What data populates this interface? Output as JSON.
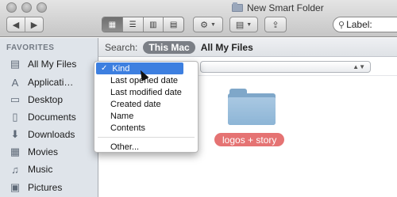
{
  "window": {
    "title": "New Smart Folder",
    "controls": [
      "close",
      "minimize",
      "zoom"
    ]
  },
  "toolbar": {
    "nav": {
      "back_glyph": "◀",
      "forward_glyph": "▶"
    },
    "view_modes": [
      {
        "name": "icon-view",
        "glyph": "▦",
        "active": true
      },
      {
        "name": "list-view",
        "glyph": "☰",
        "active": false
      },
      {
        "name": "column-view",
        "glyph": "▥",
        "active": false
      },
      {
        "name": "coverflow-view",
        "glyph": "▤",
        "active": false
      }
    ],
    "action_glyph": "⚙",
    "arrange_glyph": "▤",
    "share_glyph": "⇪",
    "search_text": "Label:"
  },
  "sidebar": {
    "heading": "FAVORITES",
    "items": [
      {
        "label": "All My Files",
        "icon": "all-files-icon",
        "glyph": "▤"
      },
      {
        "label": "Applicati…",
        "icon": "applications-icon",
        "glyph": "A"
      },
      {
        "label": "Desktop",
        "icon": "desktop-icon",
        "glyph": "▭"
      },
      {
        "label": "Documents",
        "icon": "documents-icon",
        "glyph": "▯"
      },
      {
        "label": "Downloads",
        "icon": "downloads-icon",
        "glyph": "⬇"
      },
      {
        "label": "Movies",
        "icon": "movies-icon",
        "glyph": "▦"
      },
      {
        "label": "Music",
        "icon": "music-icon",
        "glyph": "♫"
      },
      {
        "label": "Pictures",
        "icon": "pictures-icon",
        "glyph": "▣"
      }
    ]
  },
  "scopebar": {
    "label": "Search:",
    "options": [
      "This Mac",
      "All My Files"
    ],
    "selected": "This Mac"
  },
  "criteria": {
    "popup_items": [
      "Kind",
      "Last opened date",
      "Last modified date",
      "Created date",
      "Name",
      "Contents",
      "Other..."
    ],
    "selected_item": "Kind",
    "check_glyph": "✓"
  },
  "results": {
    "items": [
      {
        "name": "logos + story",
        "label_color": "#e57373"
      }
    ]
  },
  "colors": {
    "accent": "#3d7fe0",
    "sidebar_bg": "#dfe4ea",
    "tag_red": "#e57373",
    "folder_blue": "#8db5d6"
  }
}
